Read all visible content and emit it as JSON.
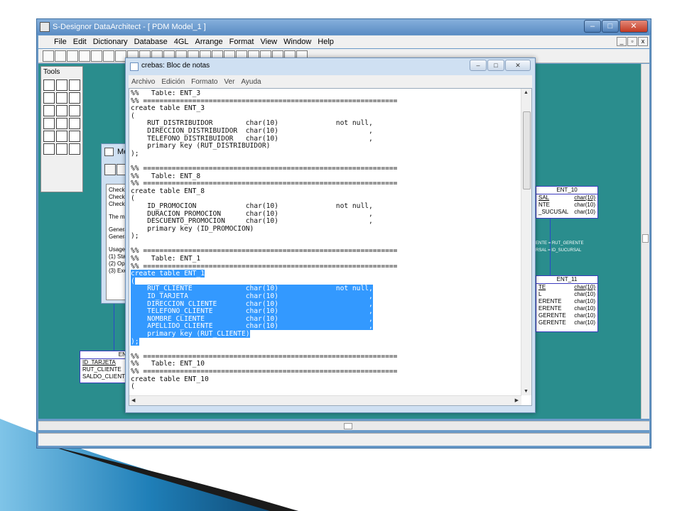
{
  "app": {
    "title": "S-Designor DataArchitect - [ PDM Model_1 ]",
    "window_controls": [
      "–",
      "□",
      "✕"
    ],
    "mdi_controls": [
      "_",
      "▫",
      "x"
    ],
    "menu": [
      "File",
      "Edit",
      "Dictionary",
      "Database",
      "4GL",
      "Arrange",
      "Format",
      "View",
      "Window",
      "Help"
    ]
  },
  "tools": {
    "title": "Tools"
  },
  "messages": {
    "title": "Messages",
    "lines": [
      "Checking Tables...",
      "Checking References",
      "Checking Indexes...",
      "",
      "The model is correct,",
      "",
      "Generating script for",
      "Generation successf",
      "",
      "Usage:",
      " (1) Start the SQL in",
      " (2) Open the script",
      " (3) Execute the scri"
    ]
  },
  "entities": {
    "ent_left": {
      "name": "ENT_",
      "rows": [
        {
          "field": "ID_TARJETA",
          "type": ""
        },
        {
          "field": "RUT_CLIENTE",
          "type": ""
        },
        {
          "field": "SALDO_CLIENTE",
          "type": ""
        }
      ]
    },
    "ent_10": {
      "name": "ENT_10",
      "rows": [
        {
          "field": "SAL",
          "type": "char(10)"
        },
        {
          "field": "NTE",
          "type": "char(10)"
        },
        {
          "field": "_SUCUSAL",
          "type": "char(10)"
        }
      ]
    },
    "ent_11": {
      "name": "ENT_11",
      "rows": [
        {
          "field": "TE",
          "type": "char(10)"
        },
        {
          "field": "L",
          "type": "char(10)"
        },
        {
          "field": "ERENTE",
          "type": "char(10)"
        },
        {
          "field": "ERENTE",
          "type": "char(10)"
        },
        {
          "field": "GERENTE",
          "type": "char(10)"
        },
        {
          "field": "GERENTE",
          "type": "char(10)"
        }
      ]
    },
    "relation_labels": [
      "ENTE = RUT_GERENTE",
      "RSAL = ID_SUCURSAL"
    ]
  },
  "notepad": {
    "title": "crebas: Bloc de notas",
    "window_controls": [
      "–",
      "□",
      "✕"
    ],
    "menu": [
      "Archivo",
      "Edición",
      "Formato",
      "Ver",
      "Ayuda"
    ],
    "code_before": "%%   Table: ENT_3\n%% ==============================================================\ncreate table ENT_3\n(\n    RUT_DISTRIBUIDOR        char(10)              not null,\n    DIRECCION_DISTRIBUIDOR  char(10)                      ,\n    TELEFONO_DISTRIBUIDOR   char(10)                      ,\n    primary key (RUT_DISTRIBUIDOR)\n);\n\n%% ==============================================================\n%%   Table: ENT_8\n%% ==============================================================\ncreate table ENT_8\n(\n    ID_PROMOCION            char(10)              not null,\n    DURACION_PROMOCION      char(10)                      ,\n    DESCUENTO_PROMOCION     char(10)                      ,\n    primary key (ID_PROMOCION)\n);\n\n%% ==============================================================\n%%   Table: ENT_1\n%% ==============================================================\n",
    "code_selected": "create table ENT_1\n(\n    RUT_CLIENTE             char(10)              not null,\n    ID_TARJETA              char(10)                      ,\n    DIRECCION_CLIENTE       char(10)                      ,\n    TELEFONO_CLIENTE        char(10)                      ,\n    NOMBRE_CLIENTE          char(10)                      ,\n    APELLIDO_CLIENTE        char(10)                      ,\n    primary key (RUT_CLIENTE)\n);",
    "code_after": "\n\n%% ==============================================================\n%%   Table: ENT_10\n%% ==============================================================\ncreate table ENT_10\n("
  },
  "colors": {
    "workspace": "#2a8d8d",
    "selection": "#3399ff",
    "entity_border": "#3b3bbf"
  }
}
